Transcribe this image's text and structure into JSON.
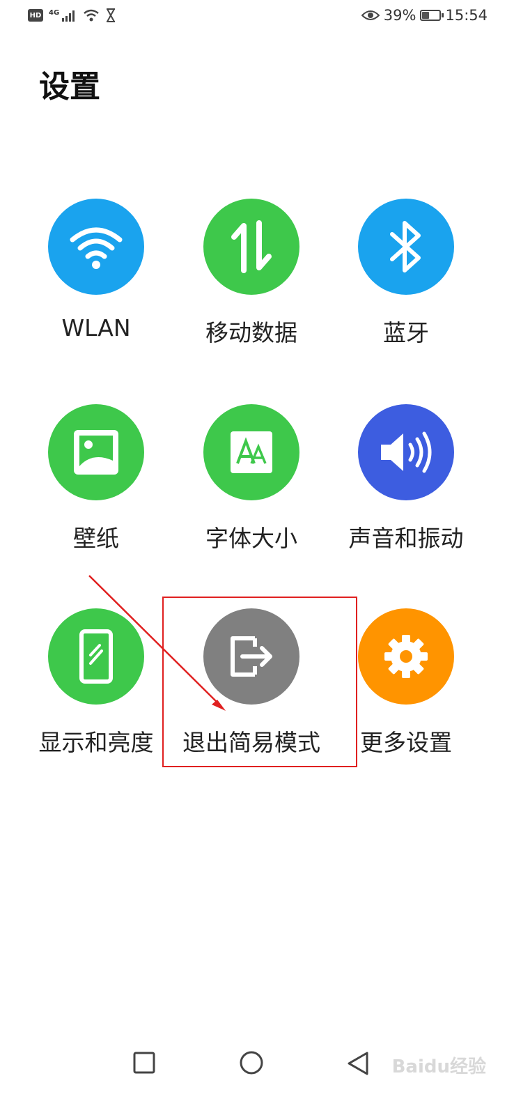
{
  "status_bar": {
    "hd": "HD",
    "network": "4G",
    "battery_percent": "39%",
    "battery_level": 0.39,
    "time": "15:54",
    "icons": [
      "hd-icon",
      "signal-icon",
      "wifi-icon",
      "hourglass-icon",
      "eye-comfort-icon",
      "battery-icon"
    ]
  },
  "page": {
    "title": "设置"
  },
  "tiles": [
    {
      "label": "WLAN",
      "icon": "wifi-icon",
      "color": "#1aa3ee"
    },
    {
      "label": "移动数据",
      "icon": "mobile-data-icon",
      "color": "#3ec84b"
    },
    {
      "label": "蓝牙",
      "icon": "bluetooth-icon",
      "color": "#1aa3ee"
    },
    {
      "label": "壁纸",
      "icon": "wallpaper-icon",
      "color": "#3ec84b"
    },
    {
      "label": "字体大小",
      "icon": "font-size-icon",
      "color": "#3ec84b"
    },
    {
      "label": "声音和振动",
      "icon": "sound-icon",
      "color": "#3d5de0"
    },
    {
      "label": "显示和亮度",
      "icon": "display-icon",
      "color": "#3ec84b"
    },
    {
      "label": "退出简易模式",
      "icon": "exit-icon",
      "color": "#808080"
    },
    {
      "label": "更多设置",
      "icon": "gear-icon",
      "color": "#ff9400"
    }
  ],
  "annotation": {
    "color": "#e02020"
  },
  "nav": {
    "icons": [
      "square-icon",
      "circle-icon",
      "triangle-icon"
    ]
  },
  "watermark": "Baidu经验"
}
